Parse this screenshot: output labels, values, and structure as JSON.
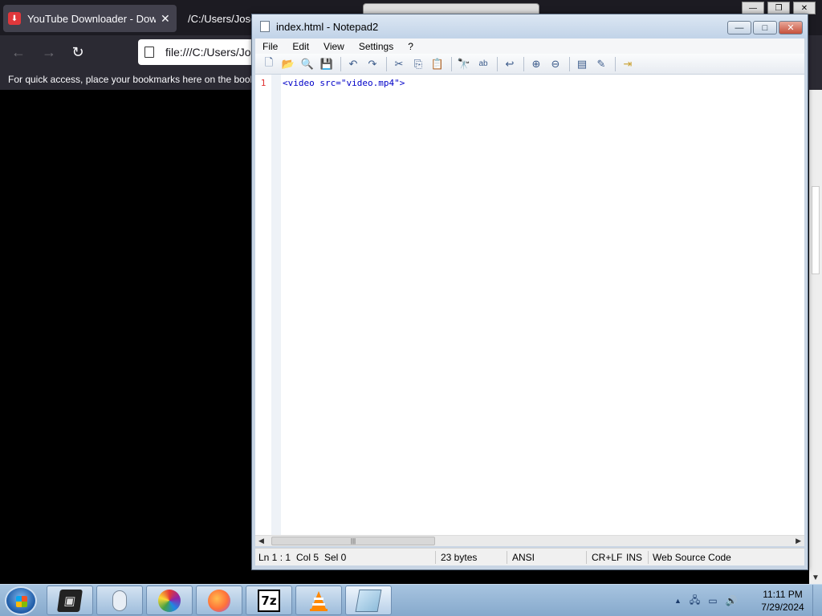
{
  "browser": {
    "tabs": [
      {
        "label": "YouTube Downloader - Download",
        "active": true
      },
      {
        "label": "/C:/Users/Jose",
        "active": false
      }
    ],
    "tab_close": "✕",
    "nav": {
      "back": "←",
      "forward": "→",
      "reload": "↻"
    },
    "url": "file:///C:/Users/Jos",
    "bookmarks_hint": "For quick access, place your bookmarks here on the book"
  },
  "notepad": {
    "title": "index.html - Notepad2",
    "menu": [
      "File",
      "Edit",
      "View",
      "Settings",
      "?"
    ],
    "controls": {
      "minimize": "—",
      "maximize": "□",
      "close": "✕"
    },
    "toolbar_icons": [
      "new-file-icon",
      "open-file-icon",
      "browse-icon",
      "save-icon",
      "undo-icon",
      "redo-icon",
      "cut-icon",
      "copy-icon",
      "paste-icon",
      "find-icon",
      "replace-icon",
      "word-wrap-icon",
      "zoom-in-icon",
      "zoom-out-icon",
      "scheme-icon",
      "customize-icon",
      "exit-icon"
    ],
    "line_number": "1",
    "code_line": "<video src=\"video.mp4\">",
    "scroll_left": "◀",
    "scroll_right": "▶",
    "scroll_grip": "|||",
    "status": {
      "position": "Ln 1 : 1",
      "column": "Col 5",
      "selection": "Sel 0",
      "size": "23 bytes",
      "encoding": "ANSI",
      "line_endings": "CR+LF",
      "mode": "INS",
      "scheme": "Web Source Code"
    }
  },
  "taskbar": {
    "apps": [
      "terminal-app-icon",
      "mouse-app-icon",
      "multimedia-app-icon",
      "firefox-icon",
      "7zip-icon",
      "vlc-icon",
      "notepad2-icon"
    ],
    "sevenzip_label": "7z",
    "tray_arrow": "▲",
    "clock_time": "11:11 PM",
    "clock_date": "7/29/2024"
  }
}
